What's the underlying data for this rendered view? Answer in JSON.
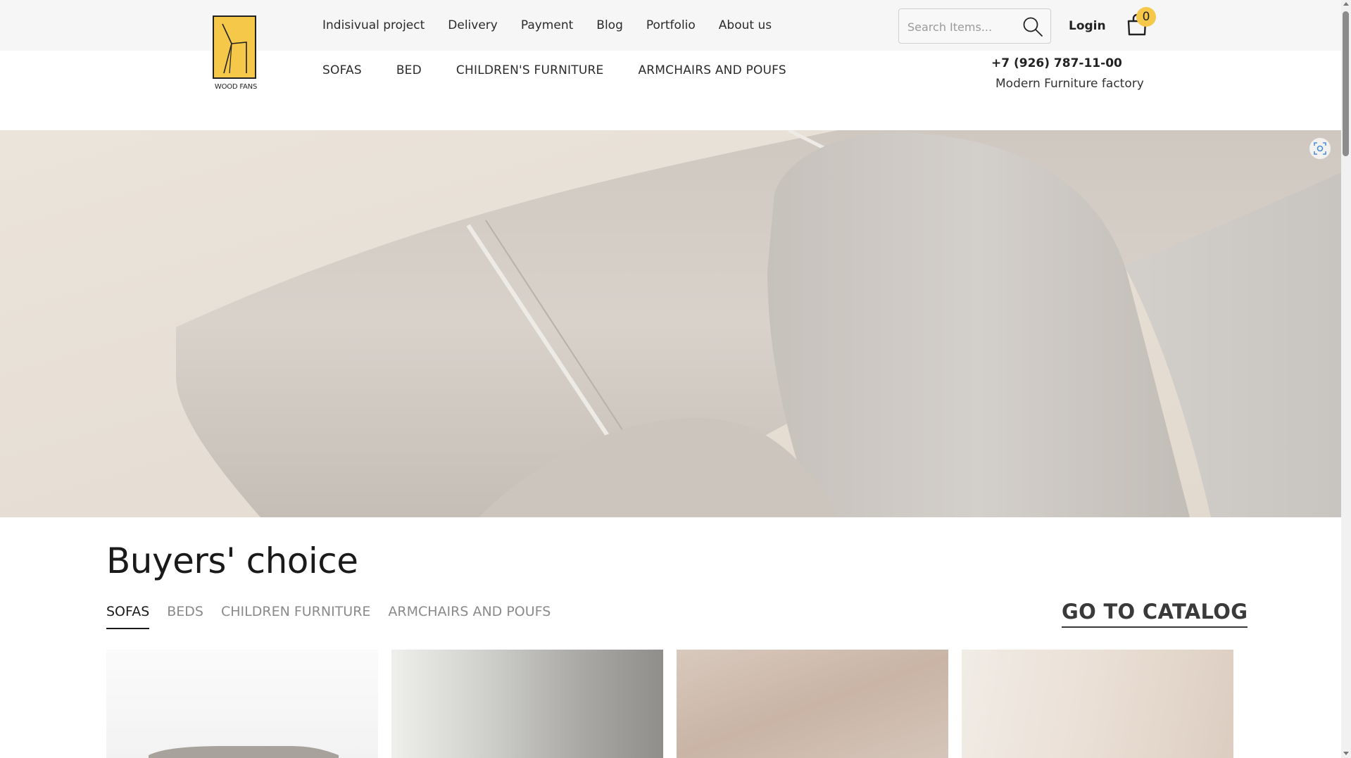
{
  "brand": {
    "logo_text": "WOOD FANS",
    "accent_color": "#f5c84a"
  },
  "header": {
    "top_nav": [
      {
        "label": "Indisivual project"
      },
      {
        "label": "Delivery"
      },
      {
        "label": "Payment"
      },
      {
        "label": "Blog"
      },
      {
        "label": "Portfolio"
      },
      {
        "label": "About us"
      }
    ],
    "search": {
      "placeholder": "Search Items...",
      "icon": "search-icon"
    },
    "login_label": "Login",
    "cart": {
      "count": "0",
      "icon": "shopping-bag-icon"
    },
    "category_nav": [
      {
        "label": "SOFAS"
      },
      {
        "label": "BED"
      },
      {
        "label": "CHILDREN'S FURNITURE"
      },
      {
        "label": "ARMCHAIRS AND POUFS"
      }
    ],
    "phone": "+7 (926) 787-11-00",
    "tagline": "Modern Furniture factory"
  },
  "hero": {
    "icon": "scan-icon"
  },
  "section": {
    "title": "Buyers' choice",
    "tabs": [
      {
        "label": "SOFAS",
        "active": true
      },
      {
        "label": "BEDS",
        "active": false
      },
      {
        "label": "CHILDREN FURNITURE",
        "active": false
      },
      {
        "label": "ARMCHAIRS AND POUFS",
        "active": false
      }
    ],
    "catalog_link": "GO TO CATALOG"
  }
}
